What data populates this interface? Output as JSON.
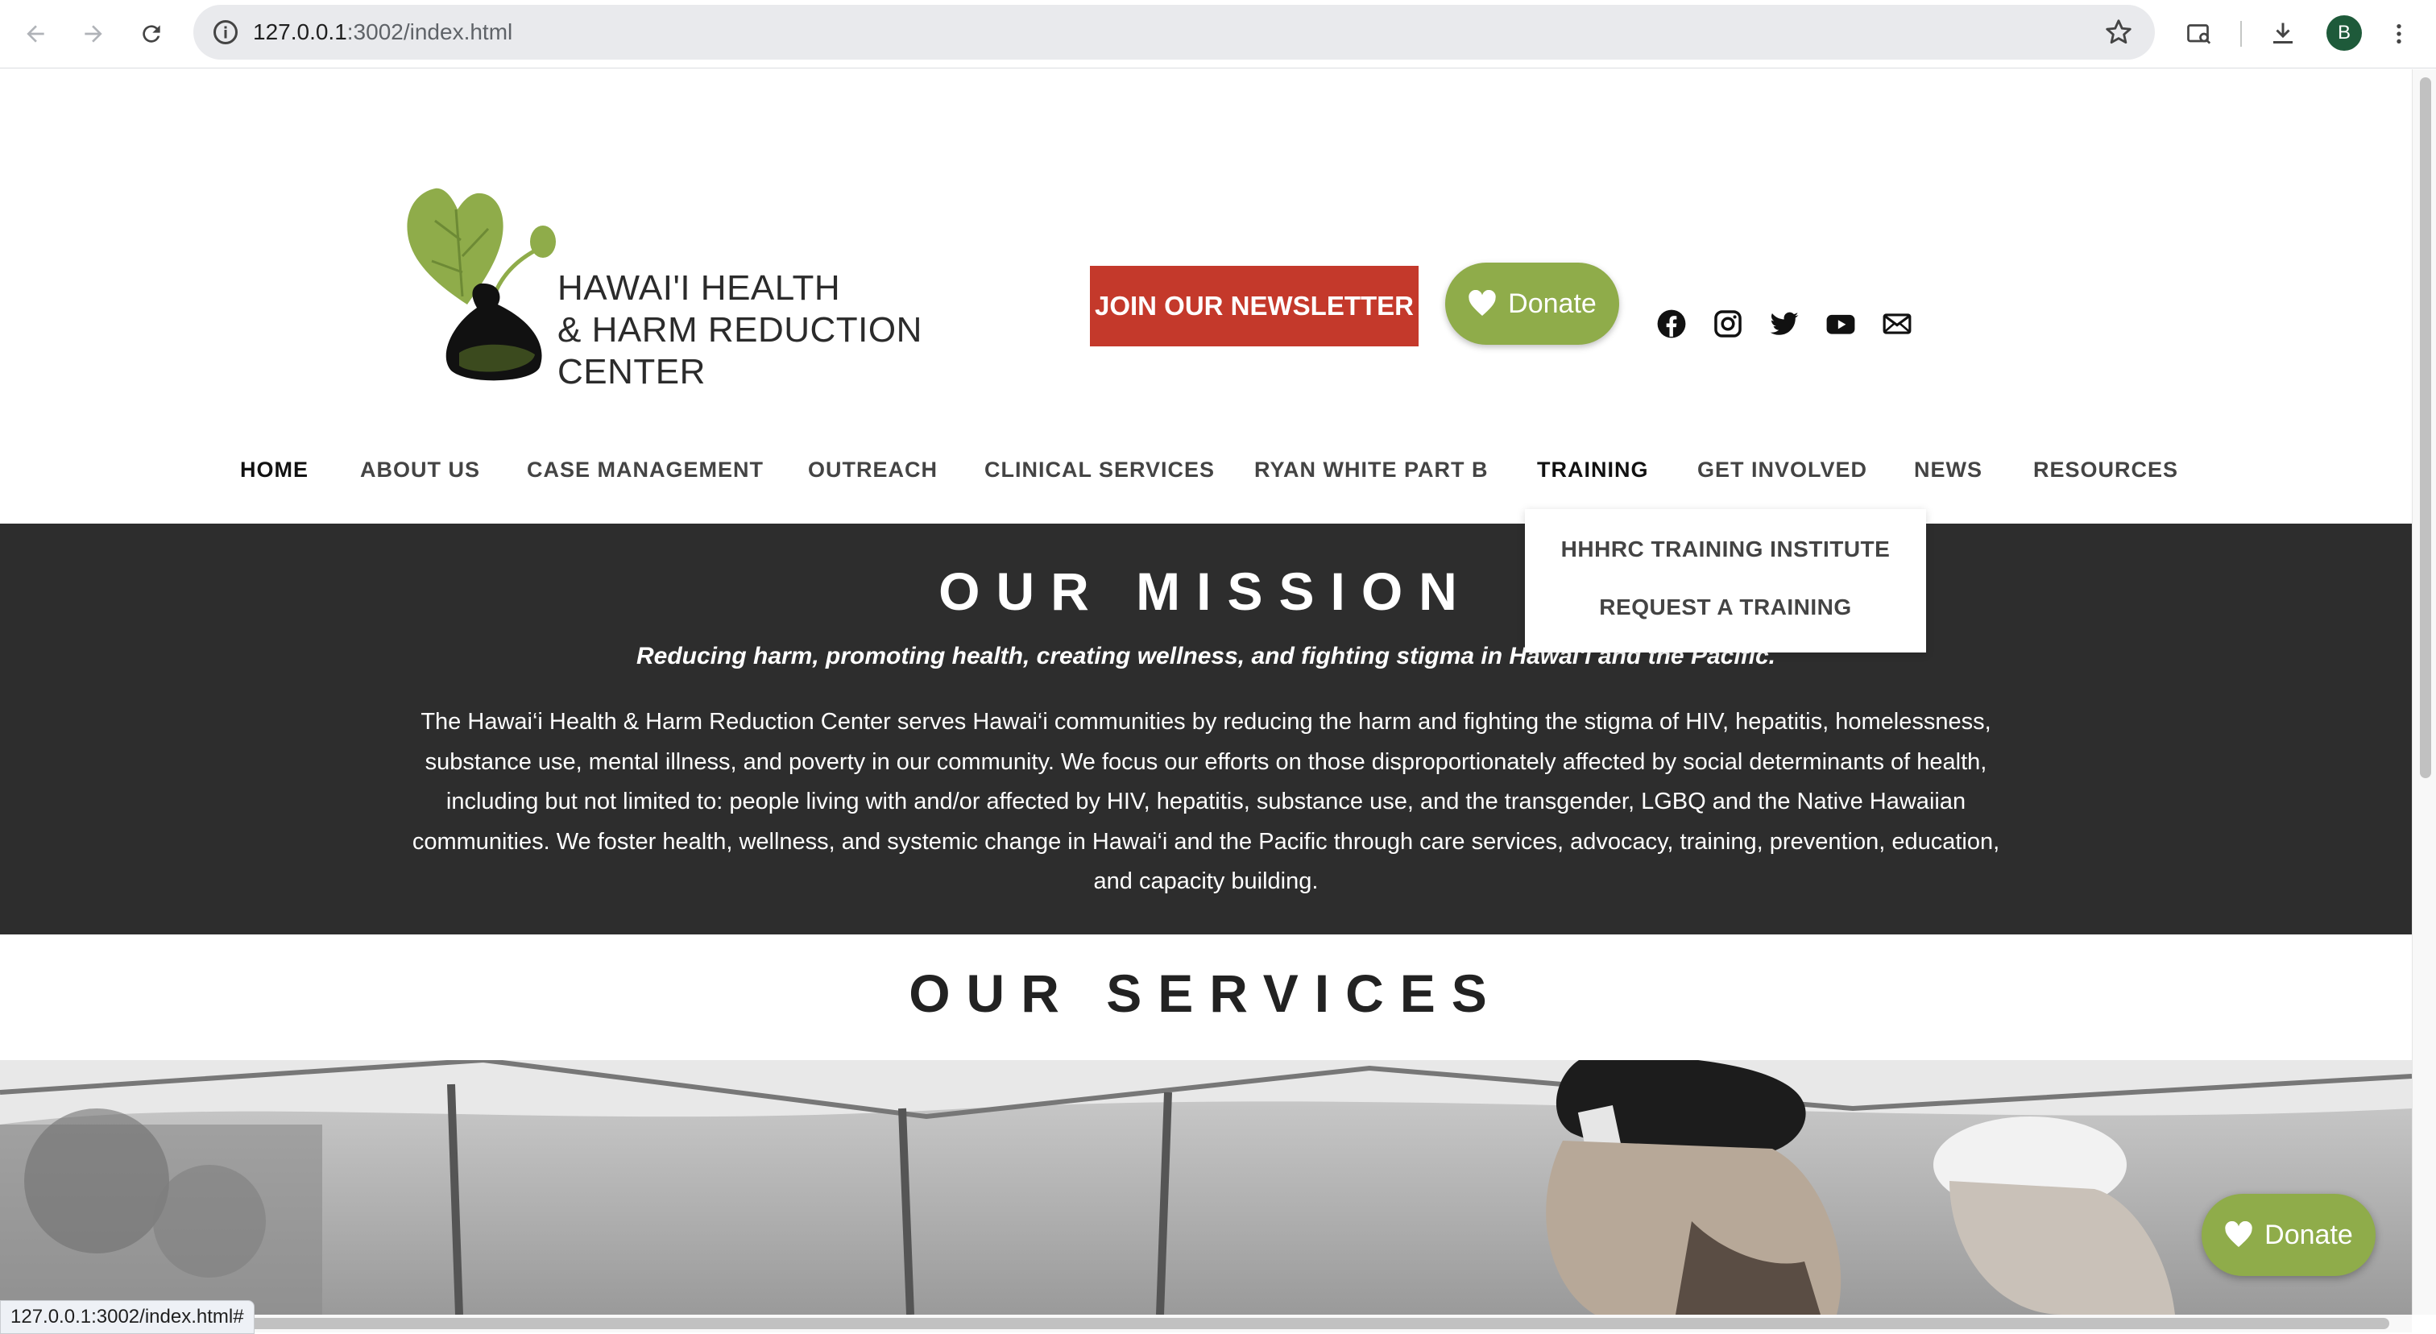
{
  "browser": {
    "url_host": "127.0.0.1",
    "url_rest": ":3002/index.html",
    "avatar_letter": "B",
    "status_url": "127.0.0.1:3002/index.html#"
  },
  "header": {
    "logo_line1": "HAWAI'I HEALTH",
    "logo_line2": "& HARM REDUCTION CENTER",
    "newsletter_label": "JOIN OUR NEWSLETTER",
    "donate_label": "Donate",
    "social": [
      "facebook-icon",
      "instagram-icon",
      "twitter-icon",
      "youtube-icon",
      "email-icon"
    ]
  },
  "nav": {
    "items": [
      "HOME",
      "ABOUT US",
      "CASE MANAGEMENT",
      "OUTREACH",
      "CLINICAL SERVICES",
      "RYAN WHITE PART B",
      "TRAINING",
      "GET INVOLVED",
      "NEWS",
      "RESOURCES"
    ],
    "active": "HOME",
    "hovered": "TRAINING",
    "training_dropdown": [
      "HHHRC TRAINING INSTITUTE",
      "REQUEST A TRAINING"
    ]
  },
  "mission": {
    "title": "OUR MISSION",
    "tagline": "Reducing harm, promoting health, creating wellness, and fighting stigma in Hawai'i and the Pacific.",
    "body": "The Hawai‘i Health & Harm Reduction Center serves Hawai‘i communities by reducing the harm and fighting the stigma of HIV, hepatitis, homelessness, substance use, mental illness, and poverty in our community. We focus our efforts on those disproportionately affected by social determinants of health, including but not limited to: people living with and/or affected by HIV, hepatitis, substance use, and the transgender, LGBQ and the Native Hawaiian communities. We foster health, wellness, and systemic change in Hawai‘i and the Pacific through care services, advocacy, training, prevention, education, and capacity building."
  },
  "services": {
    "title": "OUR SERVICES"
  },
  "floating_donate_label": "Donate",
  "colors": {
    "accent_green": "#8fac4a",
    "newsletter_red": "#c4392b",
    "mission_bg": "#2d2d2d"
  }
}
